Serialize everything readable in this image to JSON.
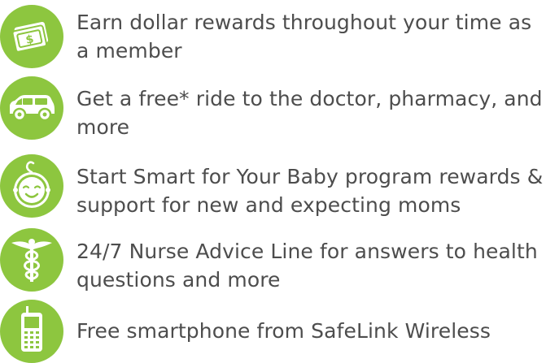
{
  "accent_color": "#8dc63f",
  "text_color": "#4d4d4d",
  "benefits": [
    {
      "icon": "dollar-bills-icon",
      "text": "Earn dollar rewards throughout your time as a member"
    },
    {
      "icon": "car-icon",
      "text": "Get a free* ride to the doctor, pharmacy, and more"
    },
    {
      "icon": "baby-face-icon",
      "text": "Start Smart for Your Baby program rewards & support for new and expecting moms"
    },
    {
      "icon": "caduceus-icon",
      "text": "24/7 Nurse Advice Line for answers to health questions and more"
    },
    {
      "icon": "cell-phone-icon",
      "text": "Free smartphone from SafeLink Wireless"
    }
  ]
}
